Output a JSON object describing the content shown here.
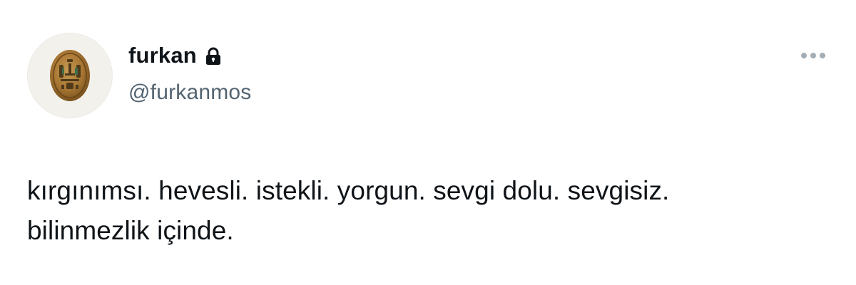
{
  "author": {
    "display_name": "furkan",
    "handle": "@furkanmos",
    "protected_icon": "lock-icon",
    "avatar_icon": "scarab-seal-avatar"
  },
  "actions": {
    "more_icon": "more-dots-icon"
  },
  "tweet": {
    "text_line_1": "kırgınımsı. hevesli. istekli. yorgun. sevgi dolu. sevgisiz.",
    "text_line_2": "bilinmezlik içinde."
  },
  "colors": {
    "text_primary": "#0f1419",
    "text_secondary": "#536471",
    "icon_muted": "#a3adb5",
    "background": "#ffffff"
  }
}
